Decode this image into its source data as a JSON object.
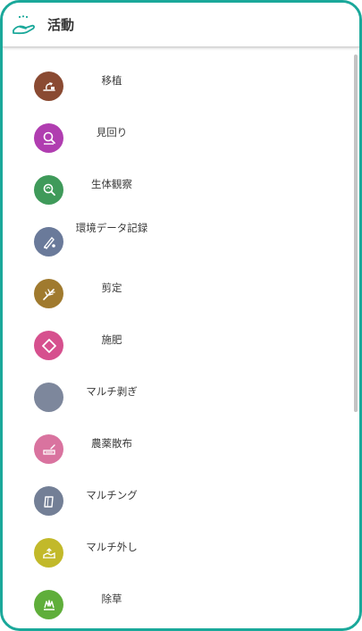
{
  "header": {
    "title": "活動",
    "icon": "hand-sprout-icon",
    "accent_color": "#1aa89a"
  },
  "activities": [
    {
      "label": "移植",
      "icon": "transplant-icon",
      "color": "#8a4a32"
    },
    {
      "label": "見回り",
      "icon": "patrol-icon",
      "color": "#b03db0"
    },
    {
      "label": "生体観察",
      "icon": "observation-icon",
      "color": "#3f9a5a"
    },
    {
      "label": "環境データ記録",
      "icon": "data-record-icon",
      "color": "#6a7a9a"
    },
    {
      "label": "剪定",
      "icon": "pruning-icon",
      "color": "#a07a2e"
    },
    {
      "label": "施肥",
      "icon": "fertilizer-icon",
      "color": "#d6508e"
    },
    {
      "label": "マルチ剥ぎ",
      "icon": "mulch-peel-icon",
      "color": "#7d879c"
    },
    {
      "label": "農薬散布",
      "icon": "pesticide-spray-icon",
      "color": "#d9739f"
    },
    {
      "label": "マルチング",
      "icon": "mulching-icon",
      "color": "#737f96"
    },
    {
      "label": "マルチ外し",
      "icon": "mulch-remove-icon",
      "color": "#c2b92a"
    },
    {
      "label": "除草",
      "icon": "weeding-icon",
      "color": "#5fae3a"
    }
  ]
}
